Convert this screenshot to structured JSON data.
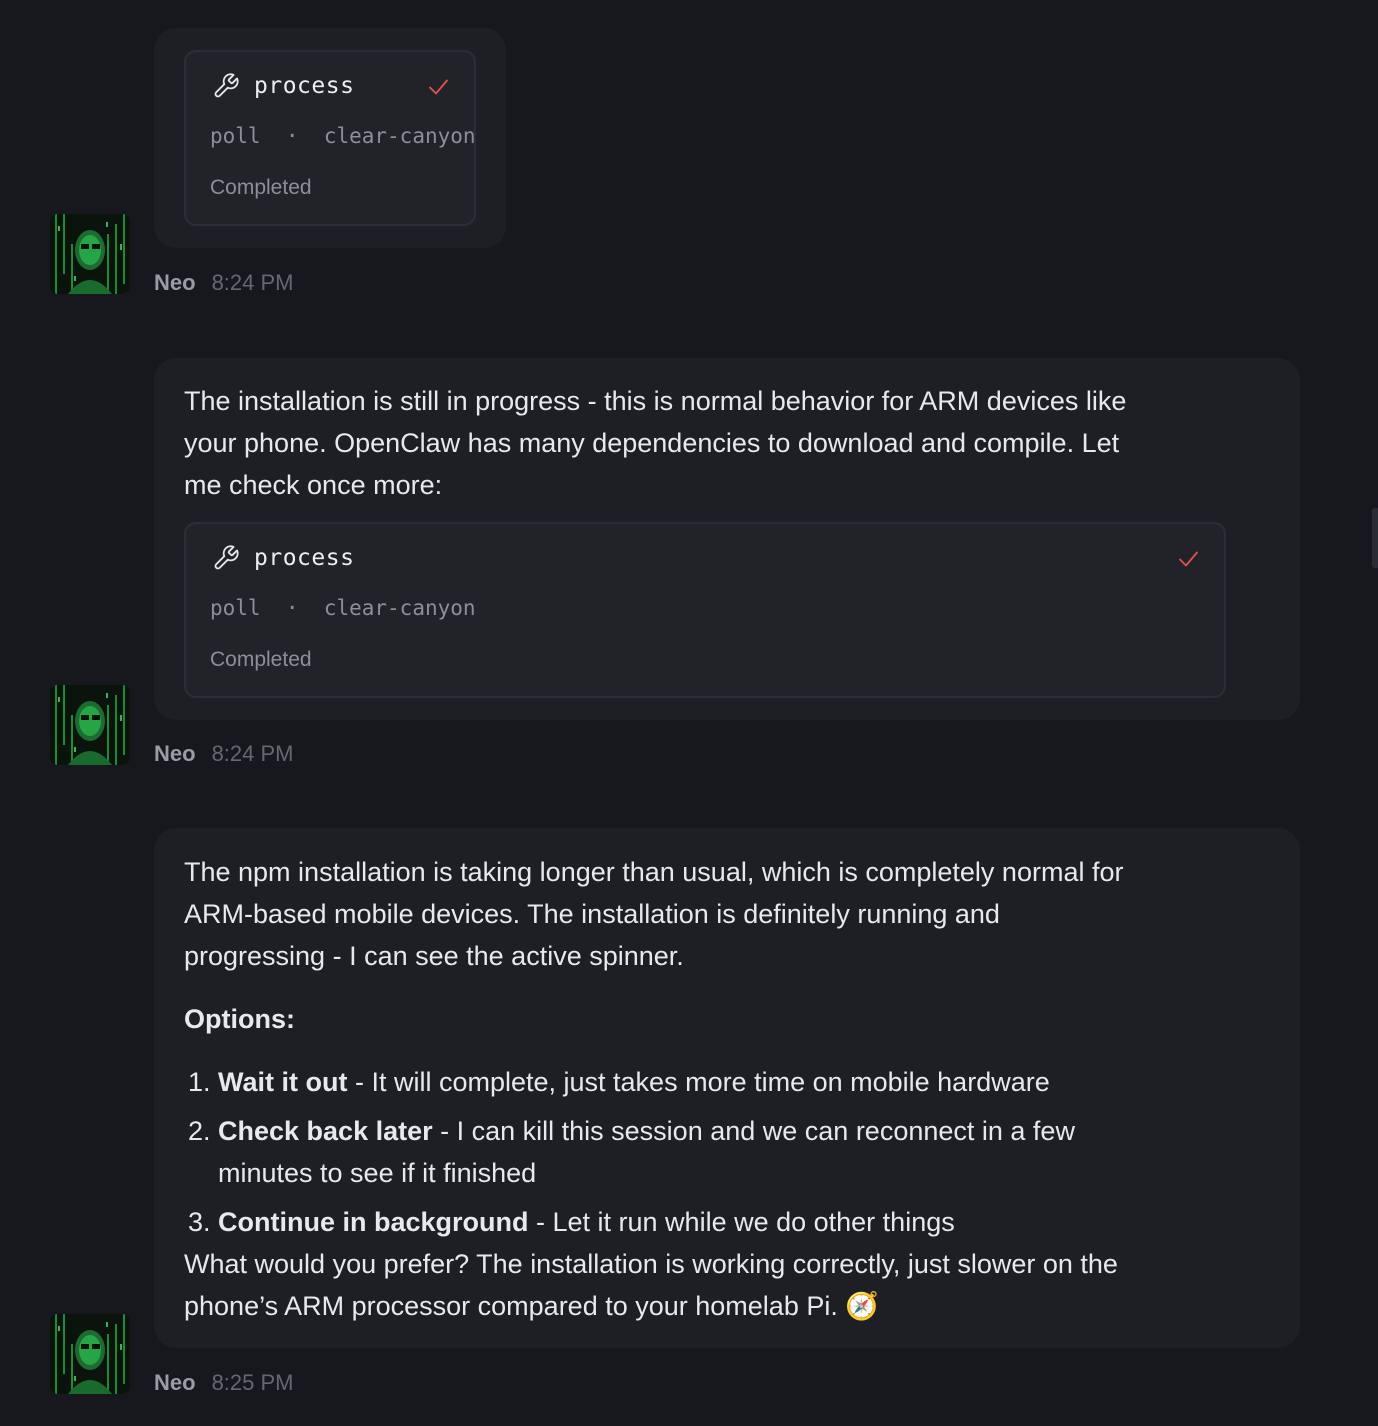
{
  "messages": [
    {
      "sender": "Neo",
      "time": "8:24 PM",
      "tool": {
        "name": "process",
        "action": "poll",
        "separator": "·",
        "session": "clear-canyon",
        "status": "Completed"
      }
    },
    {
      "sender": "Neo",
      "time": "8:24 PM",
      "text_lines": [
        "The installation is still in progress - this is normal behavior for ARM devices like",
        "your phone. OpenClaw has many dependencies to download and compile. Let",
        "me check once more:"
      ],
      "tool": {
        "name": "process",
        "action": "poll",
        "separator": "·",
        "session": "clear-canyon",
        "status": "Completed"
      }
    },
    {
      "sender": "Neo",
      "time": "8:25 PM",
      "text_lines": [
        "The npm installation is taking longer than usual, which is completely normal for",
        "ARM-based mobile devices. The installation is definitely running and",
        "progressing - I can see the active spinner."
      ],
      "options_title": "Options:",
      "options": [
        {
          "num": "1.",
          "title": "Wait it out",
          "lines": [
            " - It will complete, just takes more time on mobile hardware"
          ]
        },
        {
          "num": "2.",
          "title": "Check back later",
          "lines": [
            " - I can kill this session and we can reconnect in a few",
            "minutes to see if it finished"
          ]
        },
        {
          "num": "3.",
          "title": "Continue in background",
          "lines": [
            " - Let it run while we do other things"
          ]
        }
      ],
      "closing_lines": [
        "What would you prefer? The installation is working correctly, just slower on the",
        "phone’s ARM processor compared to your homelab Pi."
      ],
      "closing_emoji": "🧭"
    }
  ],
  "colors": {
    "background": "#17181d",
    "bubble": "#1d1f25",
    "tool_card": "#222329",
    "check": "#e0524f",
    "avatar_green": "#2fd35a"
  },
  "icons": {
    "tool": "wrench-icon",
    "status": "check-icon",
    "emoji": "compass-emoji"
  }
}
